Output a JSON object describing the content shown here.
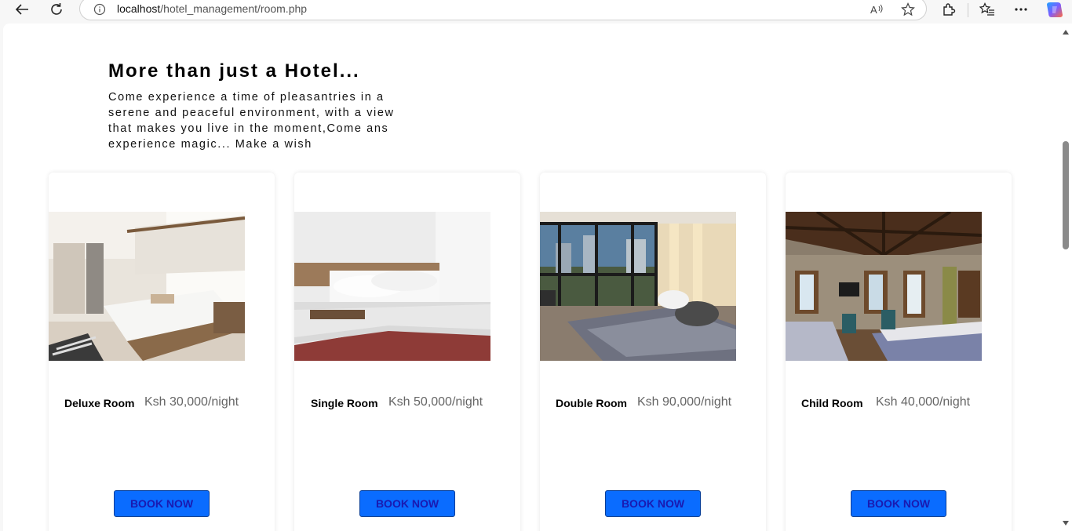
{
  "browser": {
    "url_host": "localhost",
    "url_path": "/hotel_management/room.php"
  },
  "hero": {
    "title": "More than just a Hotel...",
    "text": "Come experience a time of pleasantries in a serene and peaceful environment, with a view that makes you live in the moment,Come ans experience magic... Make a wish"
  },
  "rooms": [
    {
      "name": "Deluxe Room",
      "price": "Ksh 30,000/night",
      "button": "BOOK NOW"
    },
    {
      "name": "Single Room",
      "price": "Ksh 50,000/night",
      "button": "BOOK NOW"
    },
    {
      "name": "Double Room",
      "price": "Ksh 90,000/night",
      "button": "BOOK NOW"
    },
    {
      "name": "Child Room",
      "price": "Ksh 40,000/night",
      "button": "BOOK NOW"
    }
  ]
}
